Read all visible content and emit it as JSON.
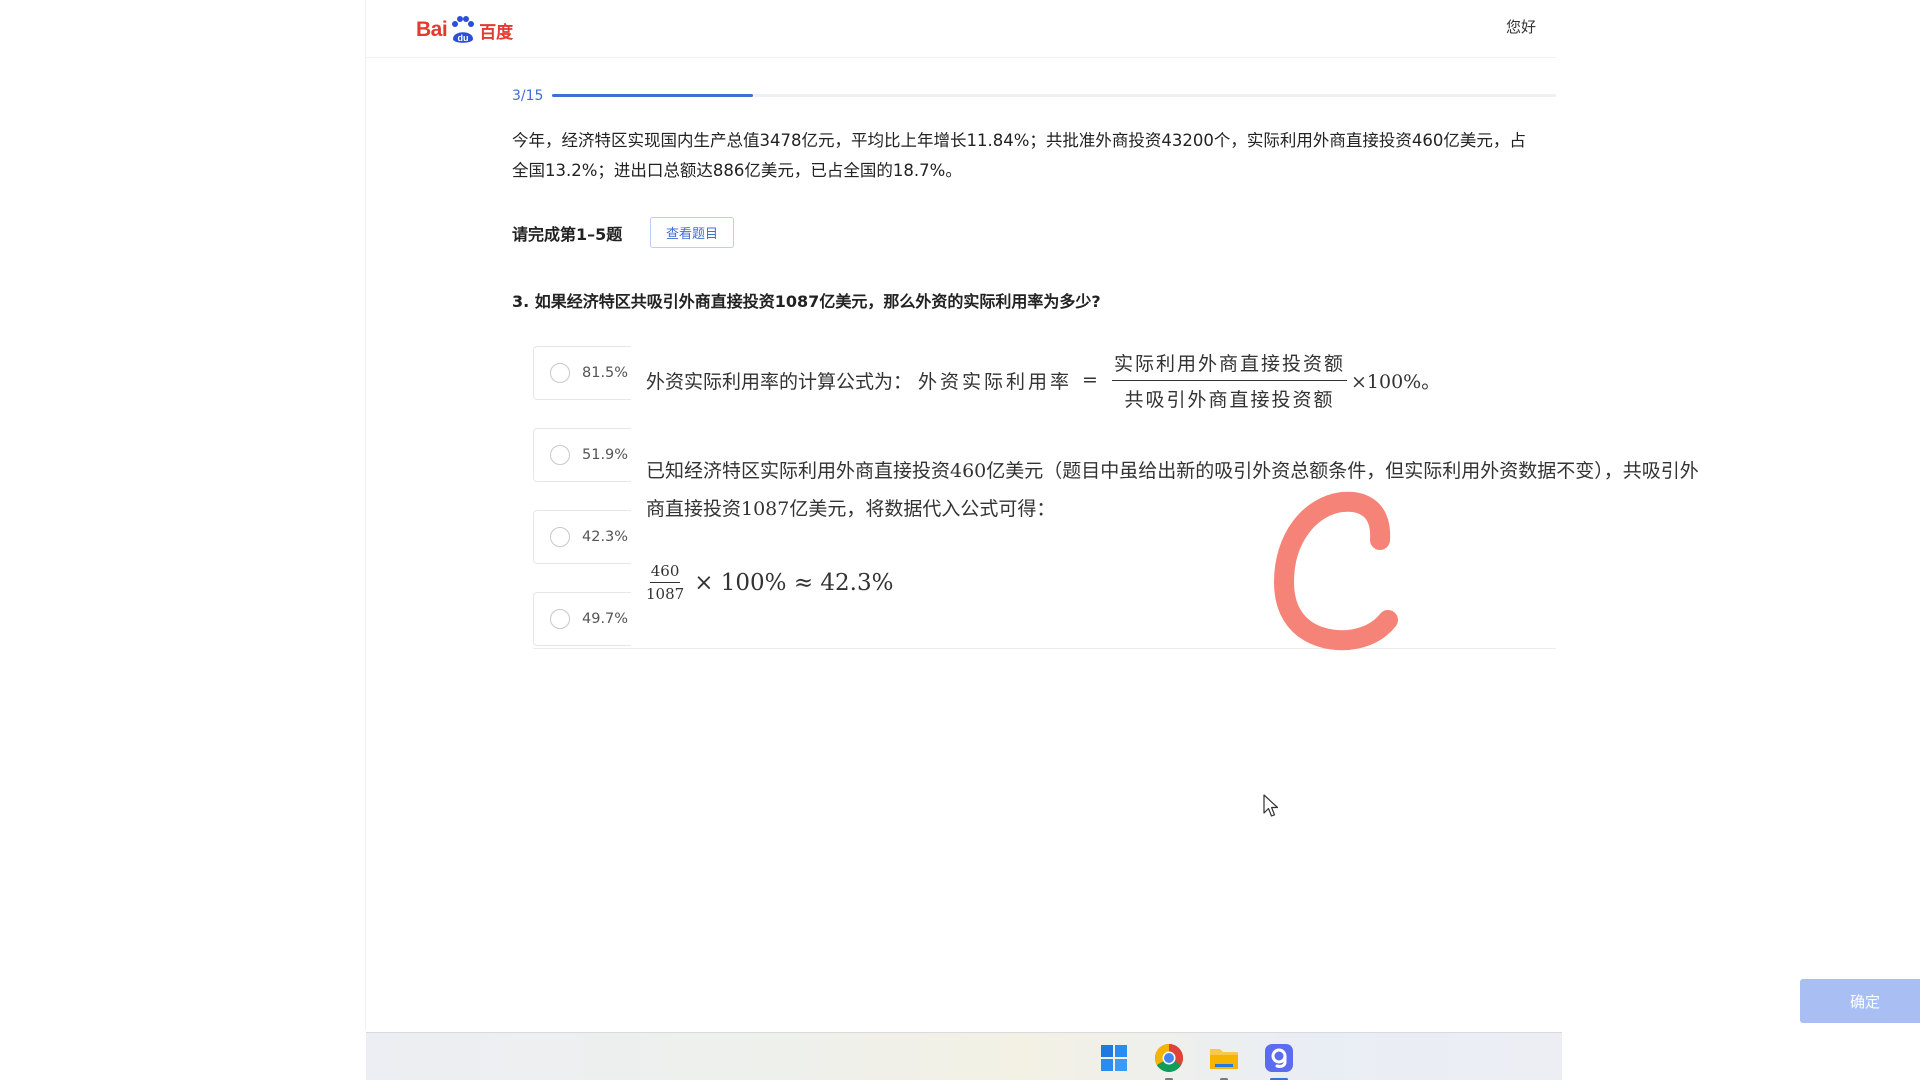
{
  "header": {
    "logo_latin": "Bai",
    "logo_du": "du",
    "logo_cn": "百度",
    "greeting": "您好"
  },
  "progress": {
    "label": "3/15",
    "fraction": 0.2
  },
  "passage": "今年，经济特区实现国内生产总值3478亿元，平均比上年增长11.84%；共批准外商投资43200个，实际利用外商直接投资460亿美元，占全国13.2%；进出口总额达886亿美元，已占全国的18.7%。",
  "instruction": {
    "text": "请完成第1–5题",
    "view_button": "查看题目"
  },
  "question": "3. 如果经济特区共吸引外商直接投资1087亿美元，那么外资的实际利用率为多少?",
  "options": [
    {
      "label": "81.5%"
    },
    {
      "label": "51.9%"
    },
    {
      "label": "42.3%"
    },
    {
      "label": "49.7%"
    }
  ],
  "explanation": {
    "formula_intro": "外资实际利用率的计算公式为：",
    "formula_lhs": "外资实际利用率",
    "formula_eq": "=",
    "formula_num": "实际利用外商直接投资额",
    "formula_den": "共吸引外商直接投资额",
    "formula_tail": "×100%。",
    "known_text": "已知经济特区实际利用外商直接投资460亿美元（题目中虽给出新的吸引外资总额条件，但实际利用外资数据不变），共吸引外商直接投资1087亿美元，将数据代入公式可得：",
    "calc_num": "460",
    "calc_den": "1087",
    "calc_rest": "× 100% ≈ 42.3%"
  },
  "answer_mark": {
    "color": "#f58378"
  },
  "confirm_button": "确定",
  "colors": {
    "accent": "#3f6fd6",
    "confirm_disabled": "#a9bff3"
  },
  "taskbar": {
    "icons": [
      "windows-start-icon",
      "chrome-icon",
      "file-explorer-icon",
      "app-g-icon"
    ]
  }
}
